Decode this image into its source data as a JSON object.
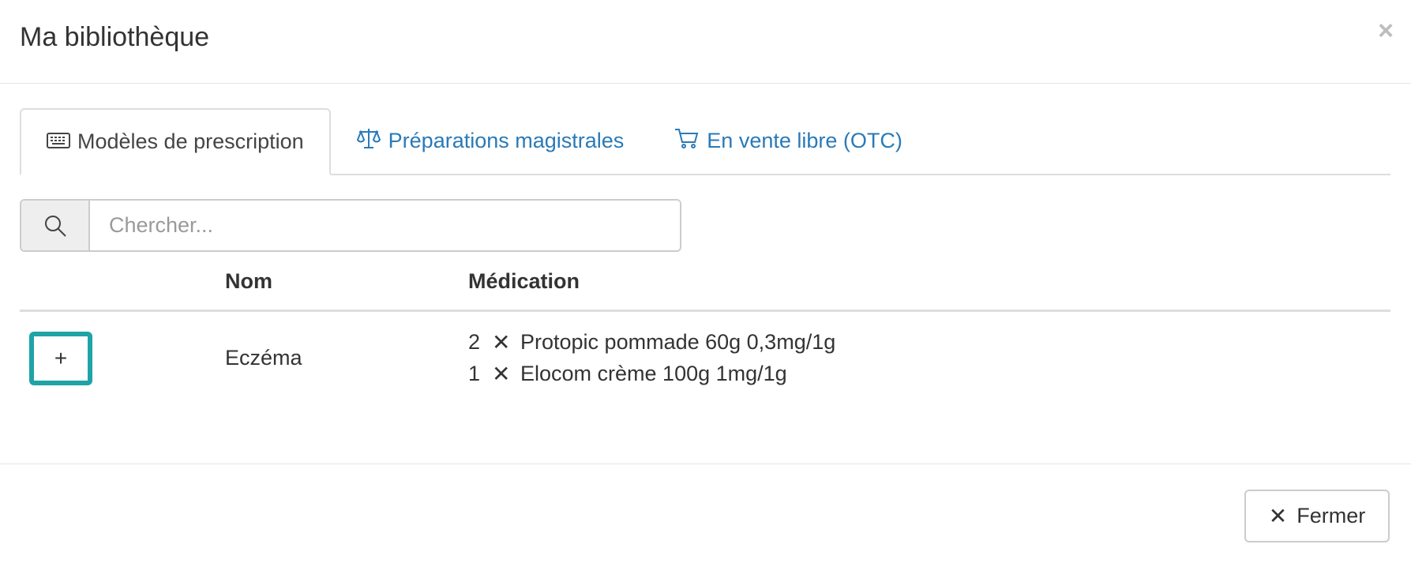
{
  "header": {
    "title": "Ma bibliothèque",
    "close_icon": "×"
  },
  "tabs": [
    {
      "label": "Modèles de prescription",
      "icon": "keyboard-icon",
      "active": true
    },
    {
      "label": "Préparations magistrales",
      "icon": "scale-icon",
      "active": false
    },
    {
      "label": "En vente libre (OTC)",
      "icon": "cart-icon",
      "active": false
    }
  ],
  "search": {
    "placeholder": "Chercher...",
    "value": "",
    "icon": "search-icon"
  },
  "table": {
    "columns": [
      "",
      "Nom",
      "Médication"
    ],
    "rows": [
      {
        "add_label": "+",
        "name": "Eczéma",
        "medications": [
          {
            "qty": "2",
            "sep": "✕",
            "name": "Protopic pommade 60g 0,3mg/1g"
          },
          {
            "qty": "1",
            "sep": "✕",
            "name": "Elocom crème 100g 1mg/1g"
          }
        ]
      }
    ]
  },
  "footer": {
    "close_icon": "✕",
    "close_label": "Fermer"
  },
  "colors": {
    "accent_link": "#2a7ab8",
    "focus_border": "#1fa3a6"
  }
}
